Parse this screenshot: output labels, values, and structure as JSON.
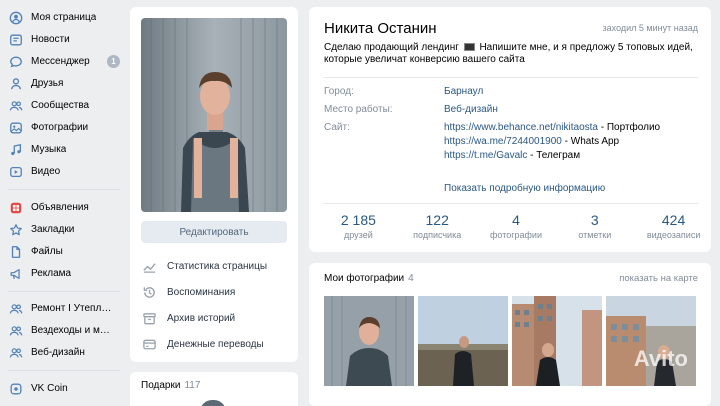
{
  "nav": {
    "items": [
      {
        "label": "Моя страница",
        "icon": "user-circle-icon"
      },
      {
        "label": "Новости",
        "icon": "newspaper-icon"
      },
      {
        "label": "Мессенджер",
        "icon": "chat-icon",
        "badge": "1"
      },
      {
        "label": "Друзья",
        "icon": "user-icon"
      },
      {
        "label": "Сообщества",
        "icon": "users-icon"
      },
      {
        "label": "Фотографии",
        "icon": "photo-icon"
      },
      {
        "label": "Музыка",
        "icon": "music-icon"
      },
      {
        "label": "Видео",
        "icon": "video-icon"
      }
    ],
    "items2": [
      {
        "label": "Объявления",
        "icon": "classifieds-icon"
      },
      {
        "label": "Закладки",
        "icon": "star-icon"
      },
      {
        "label": "Файлы",
        "icon": "file-icon"
      },
      {
        "label": "Реклама",
        "icon": "megaphone-icon"
      }
    ],
    "groups": [
      {
        "label": "Ремонт I Утепле..."
      },
      {
        "label": "Вездеходы и мот..."
      },
      {
        "label": "Веб-дизайн"
      }
    ],
    "extra": [
      {
        "label": "VK Coin"
      }
    ]
  },
  "profile": {
    "edit_label": "Редактировать",
    "menu": [
      {
        "label": "Статистика страницы",
        "icon": "stats-icon"
      },
      {
        "label": "Воспоминания",
        "icon": "history-icon"
      },
      {
        "label": "Архив историй",
        "icon": "archive-icon"
      },
      {
        "label": "Денежные переводы",
        "icon": "card-icon"
      }
    ],
    "gifts_title": "Подарки",
    "gifts_count": "117",
    "name": "Никита Останин",
    "last_seen": "заходил 5 минут назад",
    "status_part1": "Сделаю продающий лендинг",
    "status_part2": "Напишите мне, и я предложу 5 топовых идей, которые увеличат конверсию вашего сайта",
    "info": {
      "city_label": "Город:",
      "city_value": "Барнаул",
      "work_label": "Место работы:",
      "work_value": "Веб-дизайн",
      "site_label": "Сайт:",
      "sites": [
        {
          "url": "https://www.behance.net/nikitaosta",
          "suffix": " - Портфолио"
        },
        {
          "url": "https://wa.me/7244001900",
          "suffix": " - Whats App"
        },
        {
          "url": "https://t.me/Gavalc",
          "suffix": " - Телеграм"
        }
      ],
      "show_more": "Показать подробную информацию"
    },
    "counters": [
      {
        "num": "2 185",
        "label": "друзей"
      },
      {
        "num": "122",
        "label": "подписчика"
      },
      {
        "num": "4",
        "label": "фотографии"
      },
      {
        "num": "3",
        "label": "отметки"
      },
      {
        "num": "424",
        "label": "видеозаписи"
      }
    ]
  },
  "photos": {
    "title": "Мои фотографии",
    "count": "4",
    "map_link": "показать на карте",
    "watermark": "Avito"
  },
  "colors": {
    "link": "#2a5885",
    "secondary": "#818c99",
    "background": "#edeef0",
    "button": "#e5ebf1"
  }
}
